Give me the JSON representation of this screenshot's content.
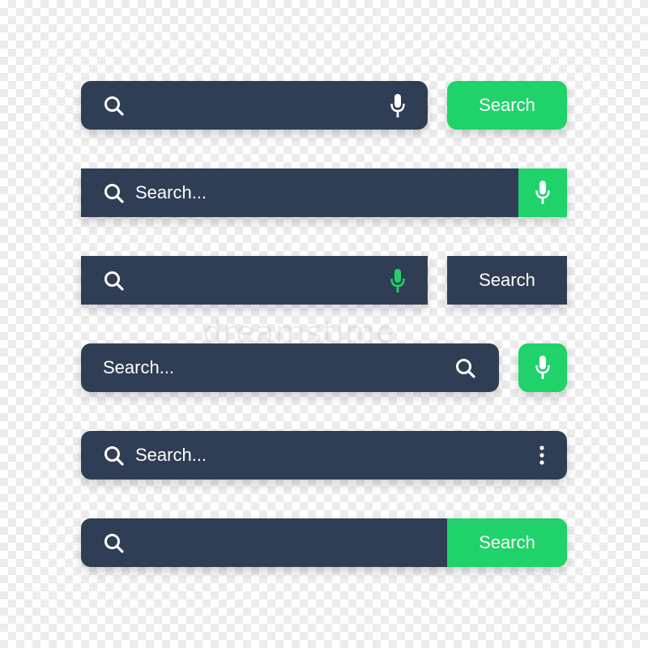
{
  "colors": {
    "bar": "#2f3e54",
    "accent": "#1fd26a",
    "text": "#ffffff"
  },
  "watermark": "dreamstime",
  "bars": [
    {
      "icons": [
        "search-icon",
        "microphone-icon"
      ],
      "button_label": "Search"
    },
    {
      "placeholder": "Search...",
      "icons": [
        "search-icon",
        "microphone-icon"
      ]
    },
    {
      "icons": [
        "search-icon",
        "microphone-icon"
      ],
      "button_label": "Search"
    },
    {
      "placeholder": "Search...",
      "icons": [
        "search-icon",
        "microphone-icon"
      ]
    },
    {
      "placeholder": "Search...",
      "icons": [
        "search-icon",
        "more-vertical-icon"
      ]
    },
    {
      "icons": [
        "search-icon"
      ],
      "button_label": "Search"
    }
  ]
}
